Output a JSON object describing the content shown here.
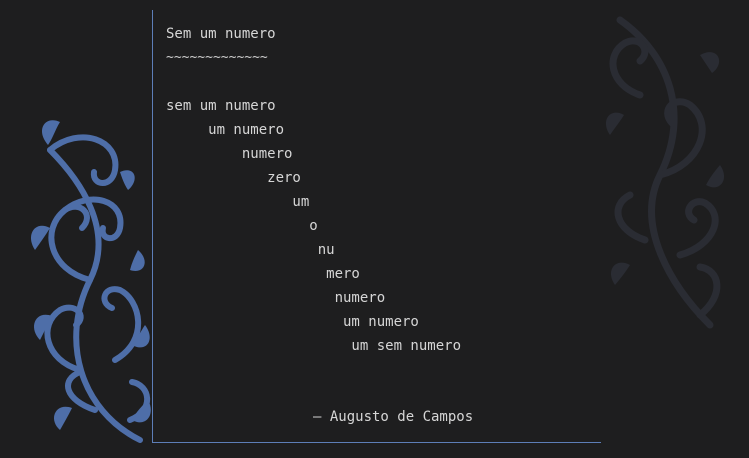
{
  "document": {
    "title": "Sem um numero",
    "underline": "~~~~~~~~~~~~~",
    "poem_lines": [
      "sem um numero",
      "     um numero",
      "         numero",
      "            zero",
      "               um",
      "                 o",
      "                  nu",
      "                   mero",
      "                    numero",
      "                     um numero",
      "                      um sem numero"
    ],
    "attribution": "— Augusto de Campos"
  },
  "decoration": {
    "left_ornament_color": "#4e6ea8",
    "right_ornament_color": "#2a2c33",
    "frame_border_color": "#5d7eb8",
    "background_color": "#1e1e1f",
    "text_color": "#d6d6d6"
  }
}
